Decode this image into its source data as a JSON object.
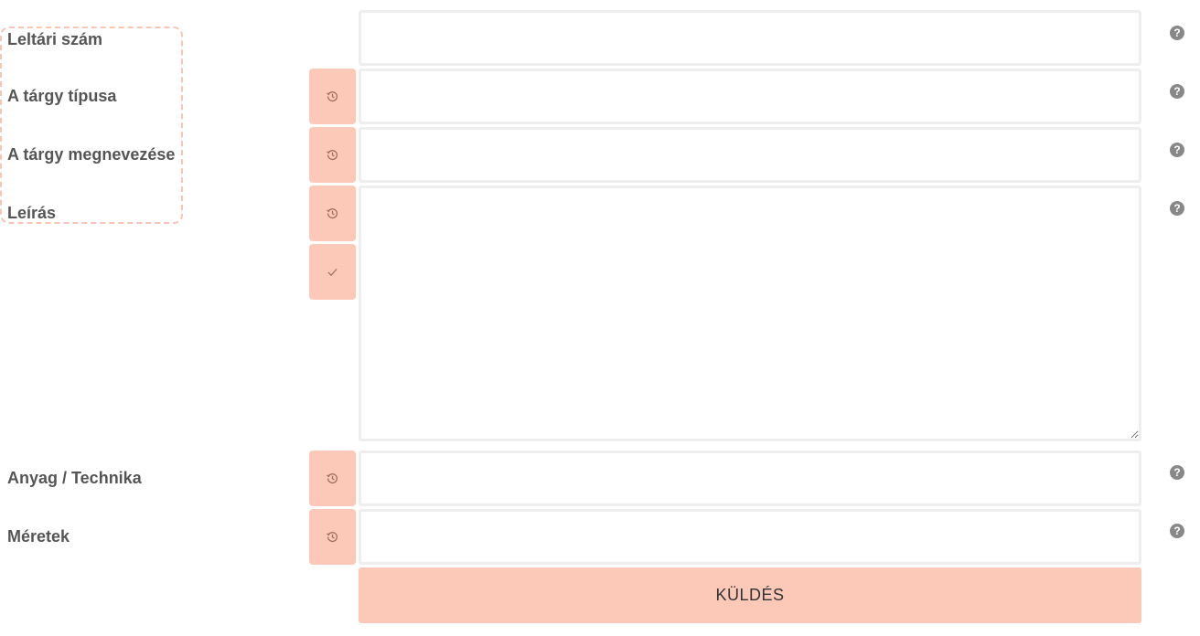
{
  "form": {
    "fields": [
      {
        "id": "leltari",
        "label": "Leltári szám",
        "value": "",
        "help": "?"
      },
      {
        "id": "tipus",
        "label": "A tárgy típusa",
        "value": "",
        "help": "?"
      },
      {
        "id": "megnevezes",
        "label": "A tárgy megnevezése",
        "value": "",
        "help": "?"
      },
      {
        "id": "leiras",
        "label": "Leírás",
        "value": "",
        "help": "?"
      },
      {
        "id": "anyag",
        "label": "Anyag / Technika",
        "value": "",
        "help": "?"
      },
      {
        "id": "meretek",
        "label": "Méretek",
        "value": "",
        "help": "?"
      }
    ],
    "submit_label": "KÜLDÉS"
  },
  "icons": {
    "history": "history-icon",
    "check": "check-icon",
    "help": "question-circle-icon"
  },
  "colors": {
    "accent": "#fcc9b8",
    "highlight_border": "#f8c4b4",
    "field_border": "#eeeeee",
    "help_icon": "#888888"
  }
}
